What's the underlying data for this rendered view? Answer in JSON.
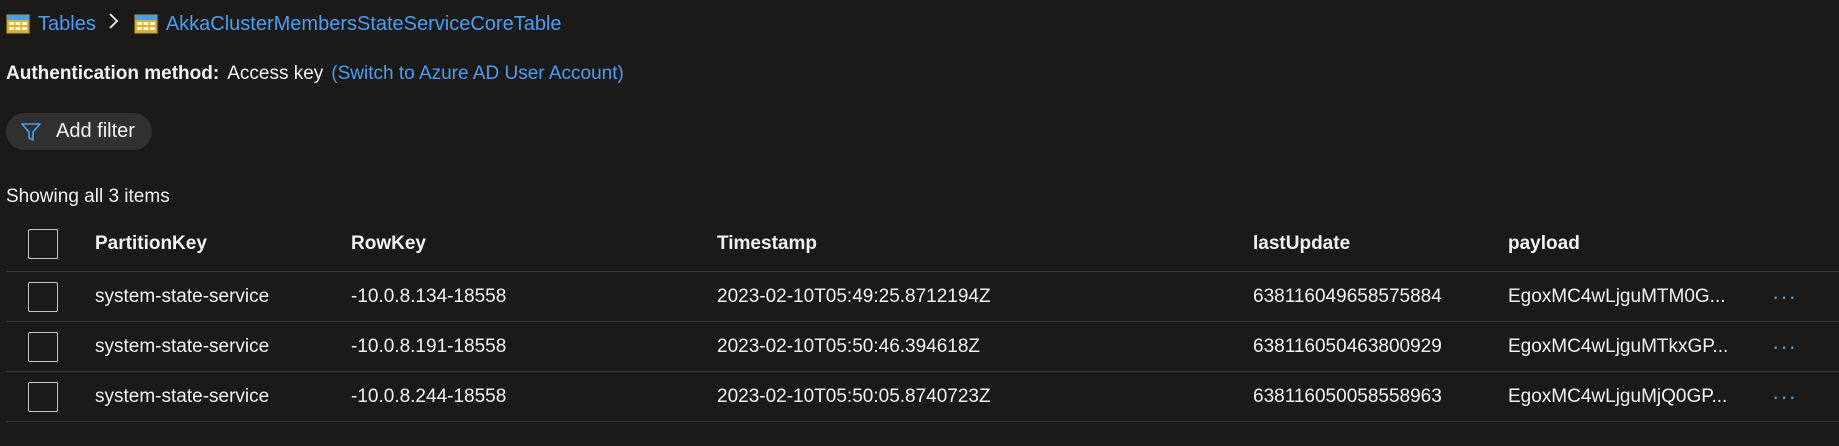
{
  "breadcrumb": {
    "root_label": "Tables",
    "current_label": "AkkaClusterMembersStateServiceCoreTable"
  },
  "auth": {
    "label": "Authentication method:",
    "value": "Access key",
    "switch_link": "(Switch to Azure AD User Account)"
  },
  "toolbar": {
    "add_filter_label": "Add filter"
  },
  "status": {
    "showing_text": "Showing all 3 items"
  },
  "table": {
    "columns": [
      "PartitionKey",
      "RowKey",
      "Timestamp",
      "lastUpdate",
      "payload"
    ],
    "rows": [
      {
        "PartitionKey": "system-state-service",
        "RowKey": "-10.0.8.134-18558",
        "Timestamp": "2023-02-10T05:49:25.8712194Z",
        "lastUpdate": "638116049658575884",
        "payload": "EgoxMC4wLjguMTM0G..."
      },
      {
        "PartitionKey": "system-state-service",
        "RowKey": "-10.0.8.191-18558",
        "Timestamp": "2023-02-10T05:50:46.394618Z",
        "lastUpdate": "638116050463800929",
        "payload": "EgoxMC4wLjguMTkxGP..."
      },
      {
        "PartitionKey": "system-state-service",
        "RowKey": "-10.0.8.244-18558",
        "Timestamp": "2023-02-10T05:50:05.8740723Z",
        "lastUpdate": "638116050058558963",
        "payload": "EgoxMC4wLjguMjQ0GP..."
      }
    ],
    "more_glyph": "···"
  },
  "colors": {
    "background": "#1b1a19",
    "link": "#479ef5",
    "text": "#f3f2f1",
    "divider": "#3b3a39",
    "pill": "#323130"
  }
}
